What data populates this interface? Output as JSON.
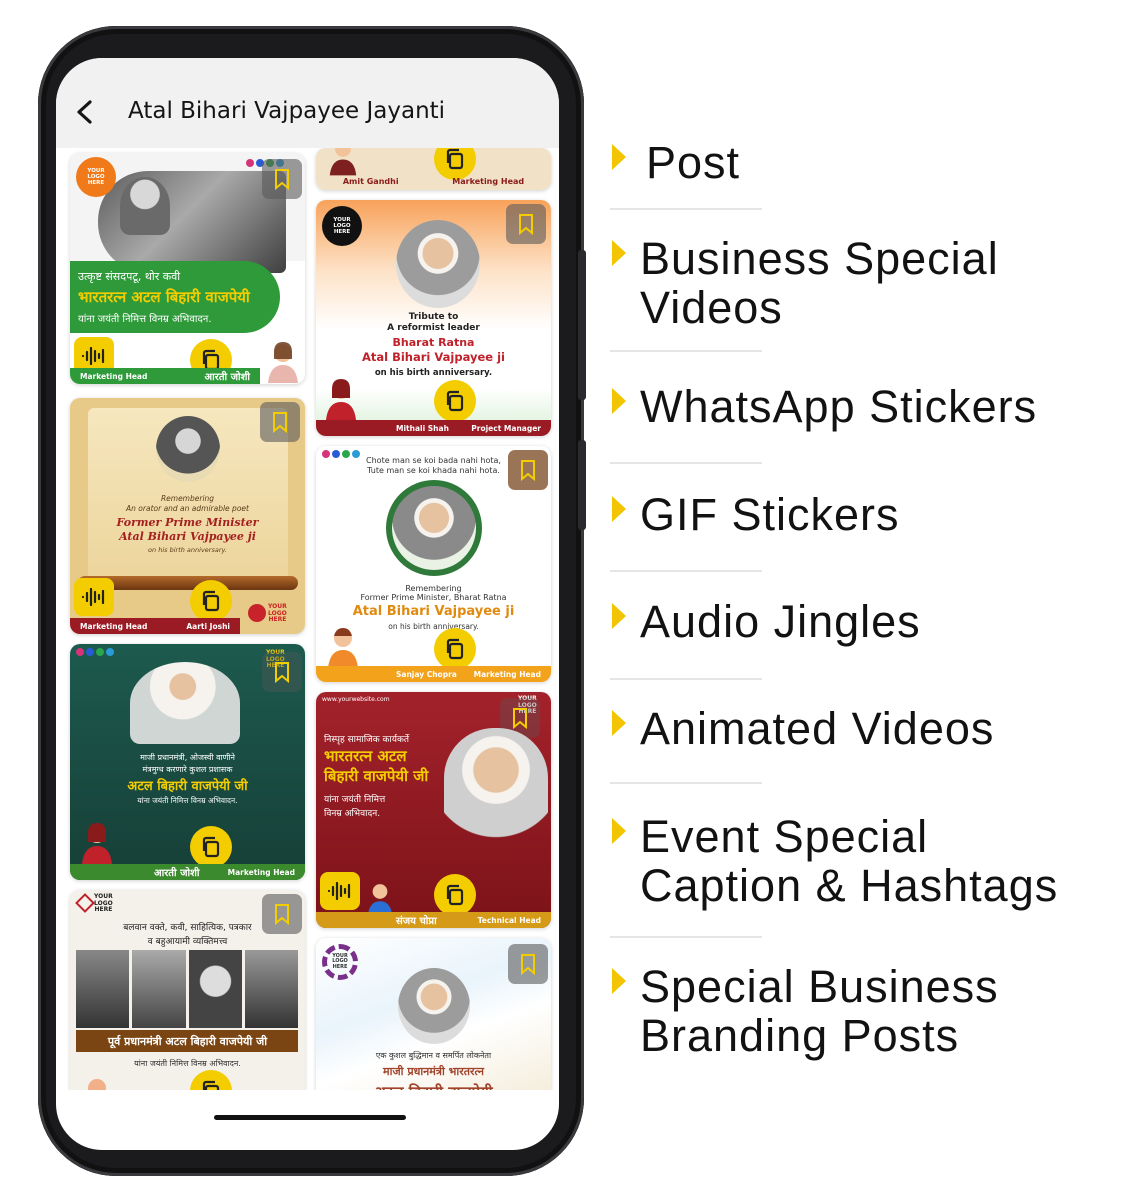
{
  "app": {
    "title": "Atal Bihari Vajpayee Jayanti"
  },
  "cards": {
    "c1": {
      "logo": "YOUR\nLOGO\nHERE",
      "line1": "उत्कृष्ट संसदपटू, थोर कवी",
      "line2": "भारतरत्न अटल बिहारी वाजपेयी",
      "line3": "यांना जयंती निमित्त विनम्र अभिवादन.",
      "role": "Marketing Head",
      "name": "आरती जोशी"
    },
    "c2": {
      "name": "Amit Gandhi",
      "role": "Marketing Head"
    },
    "c3": {
      "logo": "YOUR\nLOGO\nHERE",
      "l1": "Tribute to",
      "l2": "A reformist leader",
      "l3": "Bharat Ratna",
      "l4": "Atal Bihari Vajpayee ji",
      "l5": "on his birth anniversary.",
      "name": "Mithali Shah",
      "role": "Project Manager"
    },
    "c4": {
      "l1": "Remembering",
      "l2": "An orator and an admirable poet",
      "l3": "Former Prime Minister",
      "l4": "Atal Bihari Vajpayee ji",
      "l5": "on his birth anniversary.",
      "role": "Marketing Head",
      "name": "Aarti Joshi",
      "logo": "YOUR\nLOGO\nHERE"
    },
    "c5": {
      "q1": "Chote man se koi bada nahi hota,",
      "q2": "Tute man se koi khada nahi hota.",
      "l1": "Remembering",
      "l2": "Former Prime Minister, Bharat Ratna",
      "l3": "Atal Bihari Vajpayee ji",
      "l4": "on his birth anniversary.",
      "name": "Sanjay Chopra",
      "role": "Marketing Head"
    },
    "c6": {
      "logo": "YOUR\nLOGO\nHERE",
      "l1": "माजी प्रधानमंत्री, ओजस्वी वाणीने",
      "l2": "मंत्रमुग्ध करणारे कुशल प्रशासक",
      "l3": "अटल बिहारी वाजपेयी जी",
      "l4": "यांना जयंती निमित्त विनम्र अभिवादन.",
      "name": "आरती जोशी",
      "role": "Marketing Head"
    },
    "c7": {
      "site": "www.yourwebsite.com",
      "logo": "YOUR\nLOGO\nHERE",
      "l1": "निस्पृह सामाजिक कार्यकर्ते",
      "l2": "भारतरत्न अटल",
      "l3": "बिहारी वाजपेयी जी",
      "l4": "यांना जयंती निमित्त",
      "l5": "विनम्र अभिवादन.",
      "name": "संजय चोप्रा",
      "role": "Technical Head"
    },
    "c8": {
      "logo": "YOUR\nLOGO\nHERE",
      "l1": "बलवान वक्ते, कवी, साहित्यिक, पत्रकार",
      "l2": "व बहुआयामी व्यक्तिमत्त्व",
      "l3": "पूर्व प्रधानमंत्री अटल बिहारी वाजपेयी जी",
      "l4": "यांना जयंती निमित्त विनम्र अभिवादन."
    },
    "c9": {
      "logo": "YOUR\nLOGO\nHERE",
      "l1": "एक कुशल बुद्धिमान व समर्पित लोकनेता",
      "l2": "माजी प्रधानमंत्री भारतरत्न",
      "l3": "अटल बिहारी वाजपेयी"
    }
  },
  "features": [
    {
      "label": "Post"
    },
    {
      "label": "Business Special\nVideos"
    },
    {
      "label": "WhatsApp Stickers"
    },
    {
      "label": "GIF Stickers"
    },
    {
      "label": "Audio Jingles"
    },
    {
      "label": "Animated Videos"
    },
    {
      "label": "Event Special\nCaption & Hashtags"
    },
    {
      "label": "Special Business\nBranding Posts"
    }
  ],
  "colors": {
    "accent_yellow": "#f3cd00",
    "green": "#2e9a3a",
    "maroon": "#9b1b24",
    "dark_green": "#17473e",
    "phone_frame": "#1b1b1d"
  },
  "icons": [
    "back-arrow-icon",
    "bookmark-icon",
    "copy-icon",
    "audio-wave-icon",
    "yellow-arrow-icon"
  ]
}
